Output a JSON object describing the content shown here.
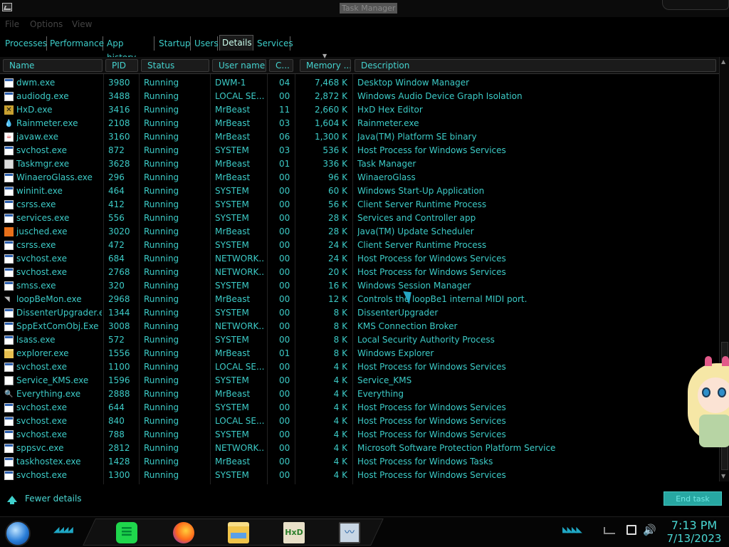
{
  "window": {
    "title": "Task Manager"
  },
  "menu": {
    "file": "File",
    "options": "Options",
    "view": "View"
  },
  "tabs": [
    {
      "label": "Processes"
    },
    {
      "label": "Performance"
    },
    {
      "label": "App history"
    },
    {
      "label": "Startup"
    },
    {
      "label": "Users"
    },
    {
      "label": "Details",
      "active": true
    },
    {
      "label": "Services"
    }
  ],
  "columns": {
    "name": "Name",
    "pid": "PID",
    "status": "Status",
    "user": "User name",
    "cpu": "C...",
    "memory": "Memory ...",
    "description": "Description",
    "sorted_by": "memory",
    "sort_direction": "descending"
  },
  "processes": [
    {
      "icon": "exe",
      "name": "dwm.exe",
      "pid": "3980",
      "status": "Running",
      "user": "DWM-1",
      "cpu": "04",
      "memory": "7,468 K",
      "description": "Desktop Window Manager"
    },
    {
      "icon": "exe",
      "name": "audiodg.exe",
      "pid": "3488",
      "status": "Running",
      "user": "LOCAL SE...",
      "cpu": "00",
      "memory": "2,872 K",
      "description": "Windows Audio Device Graph Isolation"
    },
    {
      "icon": "hxd",
      "name": "HxD.exe",
      "pid": "3416",
      "status": "Running",
      "user": "MrBeast",
      "cpu": "11",
      "memory": "2,660 K",
      "description": "HxD Hex Editor"
    },
    {
      "icon": "drop",
      "name": "Rainmeter.exe",
      "pid": "2108",
      "status": "Running",
      "user": "MrBeast",
      "cpu": "03",
      "memory": "1,604 K",
      "description": "Rainmeter.exe"
    },
    {
      "icon": "java",
      "name": "javaw.exe",
      "pid": "3160",
      "status": "Running",
      "user": "MrBeast",
      "cpu": "06",
      "memory": "1,300 K",
      "description": "Java(TM) Platform SE binary"
    },
    {
      "icon": "exe",
      "name": "svchost.exe",
      "pid": "872",
      "status": "Running",
      "user": "SYSTEM",
      "cpu": "03",
      "memory": "536 K",
      "description": "Host Process for Windows Services"
    },
    {
      "icon": "task",
      "name": "Taskmgr.exe",
      "pid": "3628",
      "status": "Running",
      "user": "MrBeast",
      "cpu": "01",
      "memory": "336 K",
      "description": "Task Manager"
    },
    {
      "icon": "exe",
      "name": "WinaeroGlass.exe",
      "pid": "296",
      "status": "Running",
      "user": "MrBeast",
      "cpu": "00",
      "memory": "96 K",
      "description": "WinaeroGlass"
    },
    {
      "icon": "exe",
      "name": "wininit.exe",
      "pid": "464",
      "status": "Running",
      "user": "SYSTEM",
      "cpu": "00",
      "memory": "60 K",
      "description": "Windows Start-Up Application"
    },
    {
      "icon": "exe",
      "name": "csrss.exe",
      "pid": "412",
      "status": "Running",
      "user": "SYSTEM",
      "cpu": "00",
      "memory": "56 K",
      "description": "Client Server Runtime Process"
    },
    {
      "icon": "exe",
      "name": "services.exe",
      "pid": "556",
      "status": "Running",
      "user": "SYSTEM",
      "cpu": "00",
      "memory": "28 K",
      "description": "Services and Controller app"
    },
    {
      "icon": "jusched",
      "name": "jusched.exe",
      "pid": "3020",
      "status": "Running",
      "user": "MrBeast",
      "cpu": "00",
      "memory": "28 K",
      "description": "Java(TM) Update Scheduler"
    },
    {
      "icon": "exe",
      "name": "csrss.exe",
      "pid": "472",
      "status": "Running",
      "user": "SYSTEM",
      "cpu": "00",
      "memory": "24 K",
      "description": "Client Server Runtime Process"
    },
    {
      "icon": "exe",
      "name": "svchost.exe",
      "pid": "684",
      "status": "Running",
      "user": "NETWORK...",
      "cpu": "00",
      "memory": "24 K",
      "description": "Host Process for Windows Services"
    },
    {
      "icon": "exe",
      "name": "svchost.exe",
      "pid": "2768",
      "status": "Running",
      "user": "NETWORK...",
      "cpu": "00",
      "memory": "20 K",
      "description": "Host Process for Windows Services"
    },
    {
      "icon": "exe",
      "name": "smss.exe",
      "pid": "320",
      "status": "Running",
      "user": "SYSTEM",
      "cpu": "00",
      "memory": "16 K",
      "description": "Windows Session Manager"
    },
    {
      "icon": "loop",
      "name": "loopBeMon.exe",
      "pid": "2968",
      "status": "Running",
      "user": "MrBeast",
      "cpu": "00",
      "memory": "12 K",
      "description": "Controls the loopBe1 internal MIDI port."
    },
    {
      "icon": "exe",
      "name": "DissenterUpgrader.exe",
      "pid": "1344",
      "status": "Running",
      "user": "SYSTEM",
      "cpu": "00",
      "memory": "8 K",
      "description": "DissenterUpgrader"
    },
    {
      "icon": "exe",
      "name": "SppExtComObj.Exe",
      "pid": "3008",
      "status": "Running",
      "user": "NETWORK...",
      "cpu": "00",
      "memory": "8 K",
      "description": "KMS Connection Broker"
    },
    {
      "icon": "exe",
      "name": "lsass.exe",
      "pid": "572",
      "status": "Running",
      "user": "SYSTEM",
      "cpu": "00",
      "memory": "8 K",
      "description": "Local Security Authority Process"
    },
    {
      "icon": "folder",
      "name": "explorer.exe",
      "pid": "1556",
      "status": "Running",
      "user": "MrBeast",
      "cpu": "01",
      "memory": "8 K",
      "description": "Windows Explorer"
    },
    {
      "icon": "exe",
      "name": "svchost.exe",
      "pid": "1100",
      "status": "Running",
      "user": "LOCAL SE...",
      "cpu": "00",
      "memory": "4 K",
      "description": "Host Process for Windows Services"
    },
    {
      "icon": "blank",
      "name": "Service_KMS.exe",
      "pid": "1596",
      "status": "Running",
      "user": "SYSTEM",
      "cpu": "00",
      "memory": "4 K",
      "description": "Service_KMS"
    },
    {
      "icon": "search",
      "name": "Everything.exe",
      "pid": "2888",
      "status": "Running",
      "user": "MrBeast",
      "cpu": "00",
      "memory": "4 K",
      "description": "Everything"
    },
    {
      "icon": "exe",
      "name": "svchost.exe",
      "pid": "644",
      "status": "Running",
      "user": "SYSTEM",
      "cpu": "00",
      "memory": "4 K",
      "description": "Host Process for Windows Services"
    },
    {
      "icon": "exe",
      "name": "svchost.exe",
      "pid": "840",
      "status": "Running",
      "user": "LOCAL SE...",
      "cpu": "00",
      "memory": "4 K",
      "description": "Host Process for Windows Services"
    },
    {
      "icon": "exe",
      "name": "svchost.exe",
      "pid": "788",
      "status": "Running",
      "user": "SYSTEM",
      "cpu": "00",
      "memory": "4 K",
      "description": "Host Process for Windows Services"
    },
    {
      "icon": "exe",
      "name": "sppsvc.exe",
      "pid": "2812",
      "status": "Running",
      "user": "NETWORK...",
      "cpu": "00",
      "memory": "4 K",
      "description": "Microsoft Software Protection Platform Service"
    },
    {
      "icon": "exe",
      "name": "taskhostex.exe",
      "pid": "1428",
      "status": "Running",
      "user": "MrBeast",
      "cpu": "00",
      "memory": "4 K",
      "description": "Host Process for Windows Tasks"
    },
    {
      "icon": "exe",
      "name": "svchost.exe",
      "pid": "1300",
      "status": "Running",
      "user": "SYSTEM",
      "cpu": "00",
      "memory": "4 K",
      "description": "Host Process for Windows Services"
    }
  ],
  "footer": {
    "fewer_details": "Fewer details",
    "end_task": "End task"
  },
  "taskbar": {
    "pinned": [
      "spotify-icon",
      "firefox-icon",
      "file-explorer-icon",
      "hxd-icon",
      "task-manager-icon"
    ],
    "time": "7:13 PM",
    "date": "7/13/2023"
  },
  "colors": {
    "text": "#3ccbc7",
    "background": "#000000",
    "accent": "#27a7a2"
  }
}
